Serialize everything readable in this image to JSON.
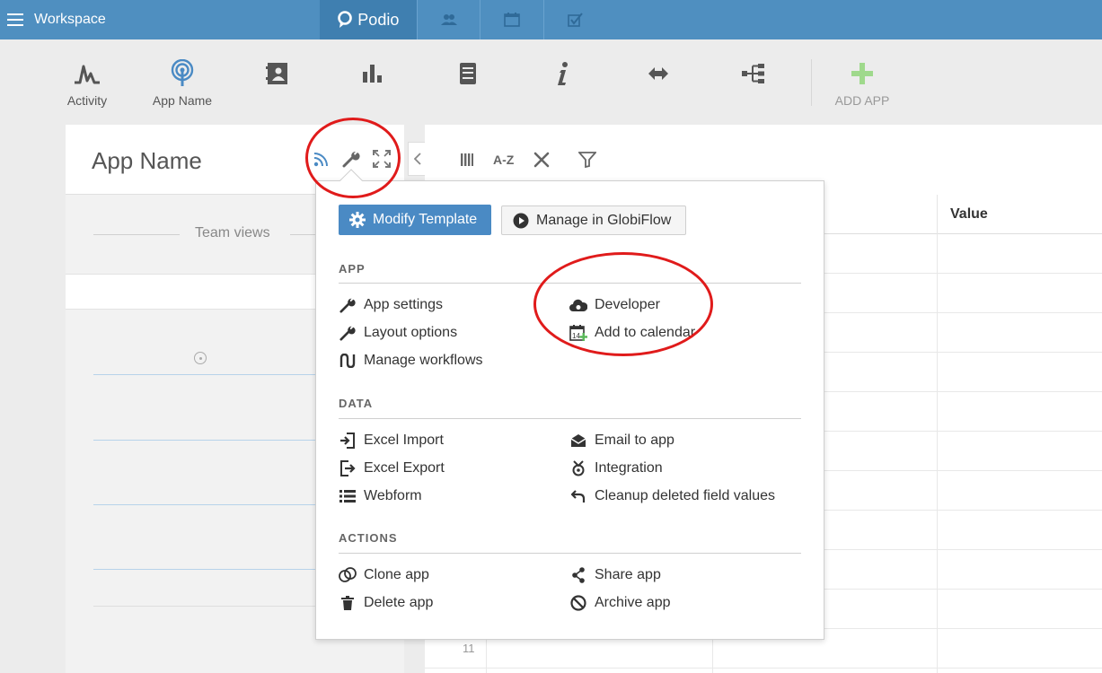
{
  "topbar": {
    "workspace_label": "Workspace",
    "brand": "Podio"
  },
  "appbar": {
    "activity_label": "Activity",
    "app_name_label": "App Name",
    "add_app_label": "ADD APP"
  },
  "left_panel": {
    "title": "App Name",
    "team_views_label": "Team views"
  },
  "table": {
    "value_header": "Value",
    "visible_row_number": "11"
  },
  "dropdown": {
    "modify_template_label": "Modify Template",
    "manage_globiflow_label": "Manage in GlobiFlow",
    "sections": {
      "app_heading": "APP",
      "data_heading": "DATA",
      "actions_heading": "ACTIONS"
    },
    "app_items": {
      "app_settings": "App settings",
      "layout_options": "Layout options",
      "manage_workflows": "Manage workflows",
      "developer": "Developer",
      "add_to_calendar": "Add to calendar"
    },
    "data_items": {
      "excel_import": "Excel Import",
      "excel_export": "Excel Export",
      "webform": "Webform",
      "email_to_app": "Email to app",
      "integration": "Integration",
      "cleanup": "Cleanup deleted field values"
    },
    "action_items": {
      "clone_app": "Clone app",
      "delete_app": "Delete app",
      "share_app": "Share app",
      "archive_app": "Archive app"
    }
  },
  "colors": {
    "topbar": "#4f8fc0",
    "primary_button": "#4a8ac4",
    "annotation_red": "#e01b1b",
    "add_app_green": "#7fcf6a"
  }
}
